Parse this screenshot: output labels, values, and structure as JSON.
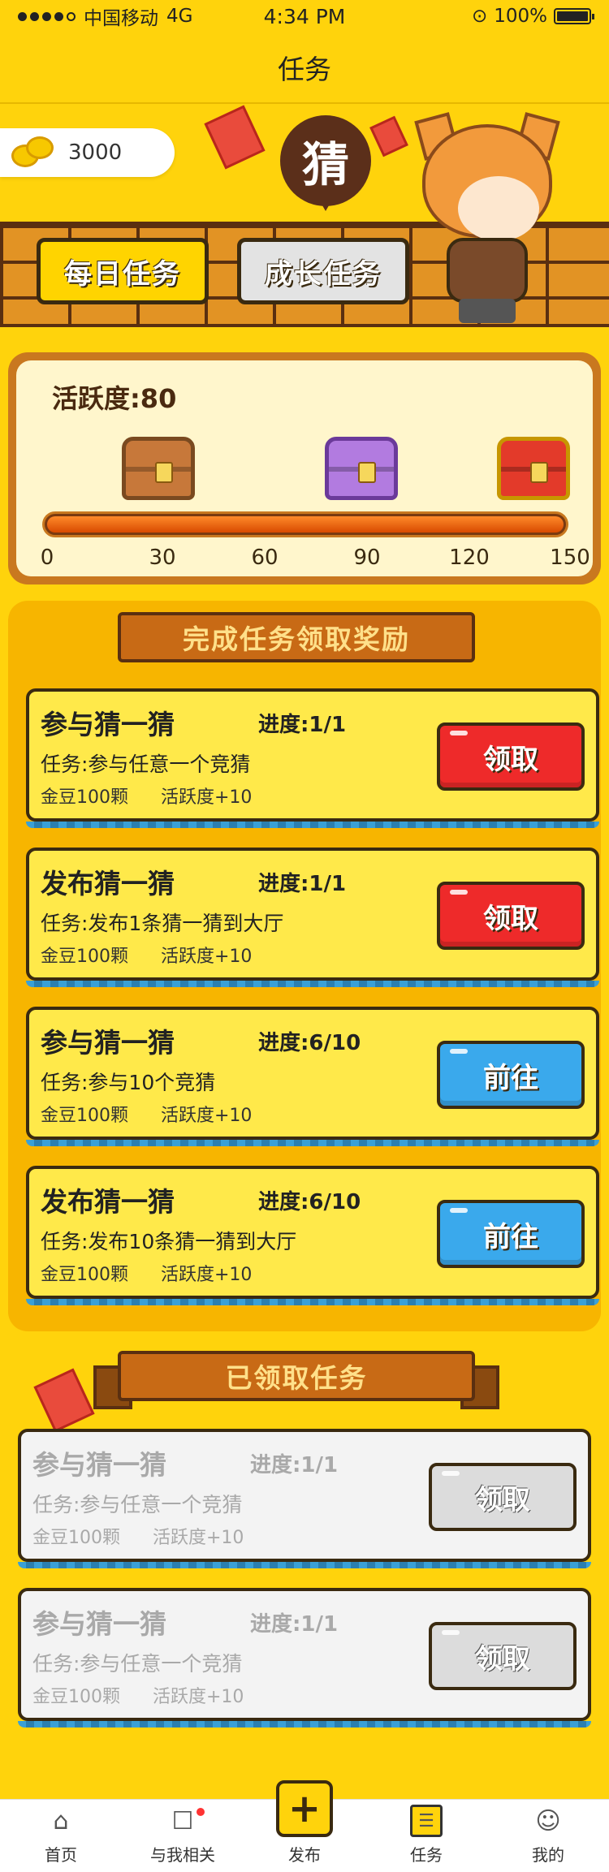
{
  "status": {
    "carrier": "中国移动",
    "network": "4G",
    "time": "4:34 PM",
    "battery": "100%"
  },
  "nav": {
    "title": "任务"
  },
  "hero": {
    "coins": "3000",
    "guess_badge": "猜",
    "tabs": [
      {
        "label": "每日任务",
        "active": true
      },
      {
        "label": "成长任务",
        "active": false
      }
    ]
  },
  "activity": {
    "title": "活跃度:80",
    "progress_value": 80,
    "progress_max": 150,
    "ticks": [
      "0",
      "30",
      "60",
      "90",
      "120",
      "150"
    ]
  },
  "complete_section": {
    "title": "完成任务领取奖励"
  },
  "tasks": [
    {
      "name": "参与猜一猜",
      "progress": "进度:1/1",
      "desc": "任务:参与任意一个竞猜",
      "coins": "金豆100颗",
      "activity": "活跃度+10",
      "button": "领取",
      "button_style": "red"
    },
    {
      "name": "发布猜一猜",
      "progress": "进度:1/1",
      "desc": "任务:发布1条猜一猜到大厅",
      "coins": "金豆100颗",
      "activity": "活跃度+10",
      "button": "领取",
      "button_style": "red"
    },
    {
      "name": "参与猜一猜",
      "progress": "进度:6/10",
      "desc": "任务:参与10个竞猜",
      "coins": "金豆100颗",
      "activity": "活跃度+10",
      "button": "前往",
      "button_style": "blue"
    },
    {
      "name": "发布猜一猜",
      "progress": "进度:6/10",
      "desc": "任务:发布10条猜一猜到大厅",
      "coins": "金豆100颗",
      "activity": "活跃度+10",
      "button": "前往",
      "button_style": "blue"
    }
  ],
  "claimed_section": {
    "title": "已领取任务"
  },
  "claimed": [
    {
      "name": "参与猜一猜",
      "progress": "进度:1/1",
      "desc": "任务:参与任意一个竞猜",
      "coins": "金豆100颗",
      "activity": "活跃度+10",
      "button": "领取"
    },
    {
      "name": "参与猜一猜",
      "progress": "进度:1/1",
      "desc": "任务:参与任意一个竞猜",
      "coins": "金豆100颗",
      "activity": "活跃度+10",
      "button": "领取"
    }
  ],
  "tabbar": [
    {
      "label": "首页",
      "icon": "home-icon"
    },
    {
      "label": "与我相关",
      "icon": "chat-icon"
    },
    {
      "label": "发布",
      "icon": "plus-icon"
    },
    {
      "label": "任务",
      "icon": "task-list-icon"
    },
    {
      "label": "我的",
      "icon": "user-icon"
    }
  ]
}
